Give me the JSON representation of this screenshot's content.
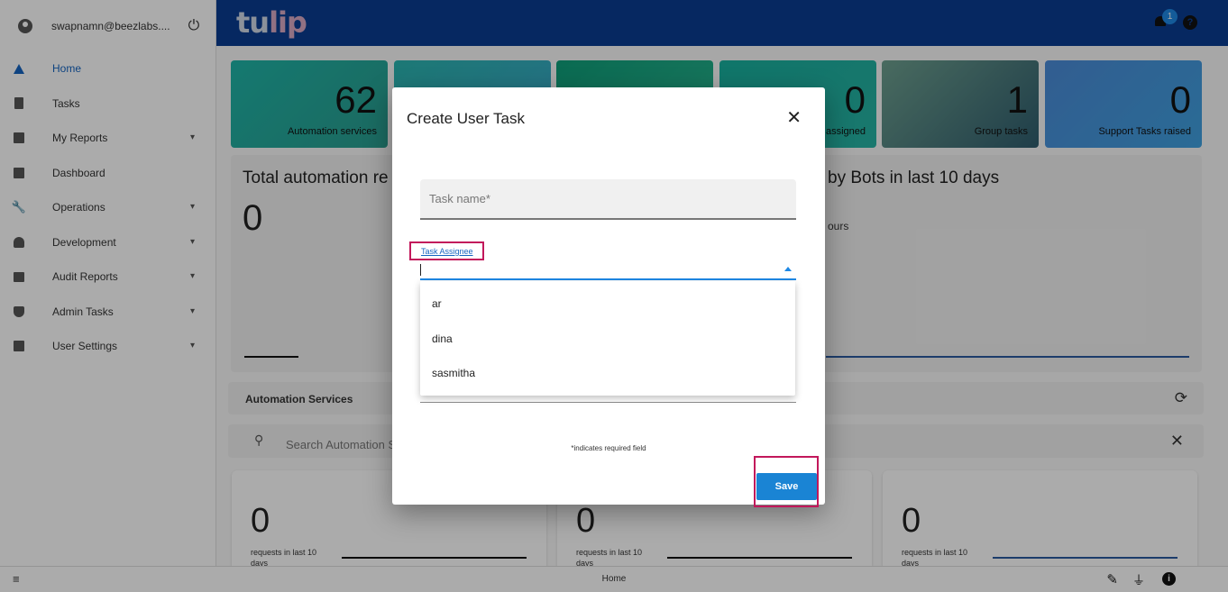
{
  "sidebar": {
    "user_email": "swapnamn@beezlabs....",
    "items": [
      {
        "label": "Home",
        "active": true,
        "has_chevron": false,
        "icon": "home-icon"
      },
      {
        "label": "Tasks",
        "active": false,
        "has_chevron": false,
        "icon": "clipboard-icon"
      },
      {
        "label": "My Reports",
        "active": false,
        "has_chevron": true,
        "icon": "report-icon"
      },
      {
        "label": "Dashboard",
        "active": false,
        "has_chevron": false,
        "icon": "dashboard-icon"
      },
      {
        "label": "Operations",
        "active": false,
        "has_chevron": true,
        "icon": "wrench-icon"
      },
      {
        "label": "Development",
        "active": false,
        "has_chevron": true,
        "icon": "developer-icon"
      },
      {
        "label": "Audit Reports",
        "active": false,
        "has_chevron": true,
        "icon": "bank-icon"
      },
      {
        "label": "Admin Tasks",
        "active": false,
        "has_chevron": true,
        "icon": "admin-shield-icon"
      },
      {
        "label": "User Settings",
        "active": false,
        "has_chevron": true,
        "icon": "settings-icon"
      }
    ]
  },
  "header": {
    "logo_text_1": "tu",
    "logo_text_2": "lip",
    "notification_count": "1",
    "help_glyph": "?"
  },
  "tiles": [
    {
      "value": "62",
      "caption": "Automation services"
    },
    {
      "value": "",
      "caption": ""
    },
    {
      "value": "",
      "caption": ""
    },
    {
      "value": "0",
      "caption": "assigned"
    },
    {
      "value": "1",
      "caption": "Group tasks"
    },
    {
      "value": "0",
      "caption": "Support Tasks raised"
    }
  ],
  "panels": {
    "left_title": "Total automation re",
    "left_value": "0",
    "right_title": "by Bots in last 10 days",
    "right_sub": "ours"
  },
  "automation_services": {
    "title": "Automation Services",
    "search_placeholder": "Search Automation S"
  },
  "cards": [
    {
      "value": "0",
      "caption": "requests in last 10 days"
    },
    {
      "value": "0",
      "caption": "requests in last 10 days"
    },
    {
      "value": "0",
      "caption": "requests in last 10 days"
    }
  ],
  "statusbar": {
    "center": "Home"
  },
  "dialog": {
    "title": "Create User Task",
    "task_name_placeholder": "Task name*",
    "assignee_label": "Task Assignee",
    "options": [
      "ar",
      "dina",
      "sasmitha"
    ],
    "required_note": "*indicates required field",
    "save_label": "Save"
  },
  "colors": {
    "header_bg": "#0a3d91",
    "accent": "#1a84d4",
    "highlight": "#c2185b"
  }
}
